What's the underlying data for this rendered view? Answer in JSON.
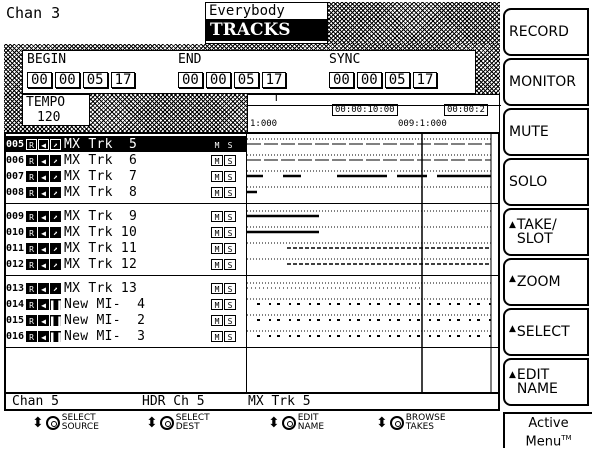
{
  "header": {
    "channel": "Chan 3",
    "project": "Everybody",
    "screen": "TRACKS"
  },
  "locate": {
    "begin_label": "BEGIN",
    "end_label": "END",
    "sync_label": "SYNC",
    "begin": [
      "00",
      "00",
      "05",
      "17"
    ],
    "end": [
      "00",
      "00",
      "05",
      "17"
    ],
    "sync": [
      "00",
      "00",
      "05",
      "17"
    ]
  },
  "tempo": {
    "label": "TEMPO",
    "value": "120"
  },
  "timeline": {
    "ruler_a": "00:00:10:00",
    "ruler_b": "00:00:2",
    "ruler_c": "1:000",
    "ruler_d": "009:1:000"
  },
  "tracks": [
    {
      "num": "005",
      "name": "MX Trk  5",
      "type": "audio",
      "selected": true
    },
    {
      "num": "006",
      "name": "MX Trk  6",
      "type": "audio",
      "selected": false
    },
    {
      "num": "007",
      "name": "MX Trk  7",
      "type": "audio",
      "selected": false
    },
    {
      "num": "008",
      "name": "MX Trk  8",
      "type": "audio",
      "selected": false
    },
    {
      "num": "009",
      "name": "MX Trk  9",
      "type": "audio",
      "selected": false
    },
    {
      "num": "010",
      "name": "MX Trk 10",
      "type": "audio",
      "selected": false
    },
    {
      "num": "011",
      "name": "MX Trk 11",
      "type": "audio",
      "selected": false
    },
    {
      "num": "012",
      "name": "MX Trk 12",
      "type": "audio",
      "selected": false
    },
    {
      "num": "013",
      "name": "MX Trk 13",
      "type": "audio",
      "selected": false
    },
    {
      "num": "014",
      "name": "New MI-  4",
      "type": "midi",
      "selected": false
    },
    {
      "num": "015",
      "name": "New MI-  2",
      "type": "midi",
      "selected": false
    },
    {
      "num": "016",
      "name": "New MI-  3",
      "type": "midi",
      "selected": false
    }
  ],
  "track_buttons": {
    "record": "R",
    "input": "I",
    "mute": "M",
    "solo": "S"
  },
  "status": {
    "channel": "Chan 5",
    "hdr": "HDR Ch 5",
    "track": "MX Trk 5"
  },
  "encoders": [
    {
      "line1": "SELECT",
      "line2": "SOURCE"
    },
    {
      "line1": "SELECT",
      "line2": "DEST"
    },
    {
      "line1": "EDIT",
      "line2": "NAME"
    },
    {
      "line1": "BROWSE",
      "line2": "TAKES"
    }
  ],
  "softkeys": [
    {
      "label": "RECORD",
      "arrow": false
    },
    {
      "label": "MONITOR",
      "arrow": false
    },
    {
      "label": "MUTE",
      "arrow": false
    },
    {
      "label": "SOLO",
      "arrow": false
    },
    {
      "label": "TAKE/ SLOT",
      "arrow": true
    },
    {
      "label": "ZOOM",
      "arrow": true
    },
    {
      "label": "SELECT",
      "arrow": true
    },
    {
      "label": "EDIT NAME",
      "arrow": true
    }
  ],
  "active_menu": {
    "line1": "Active",
    "line2": "Menu",
    "tm": "TM"
  }
}
